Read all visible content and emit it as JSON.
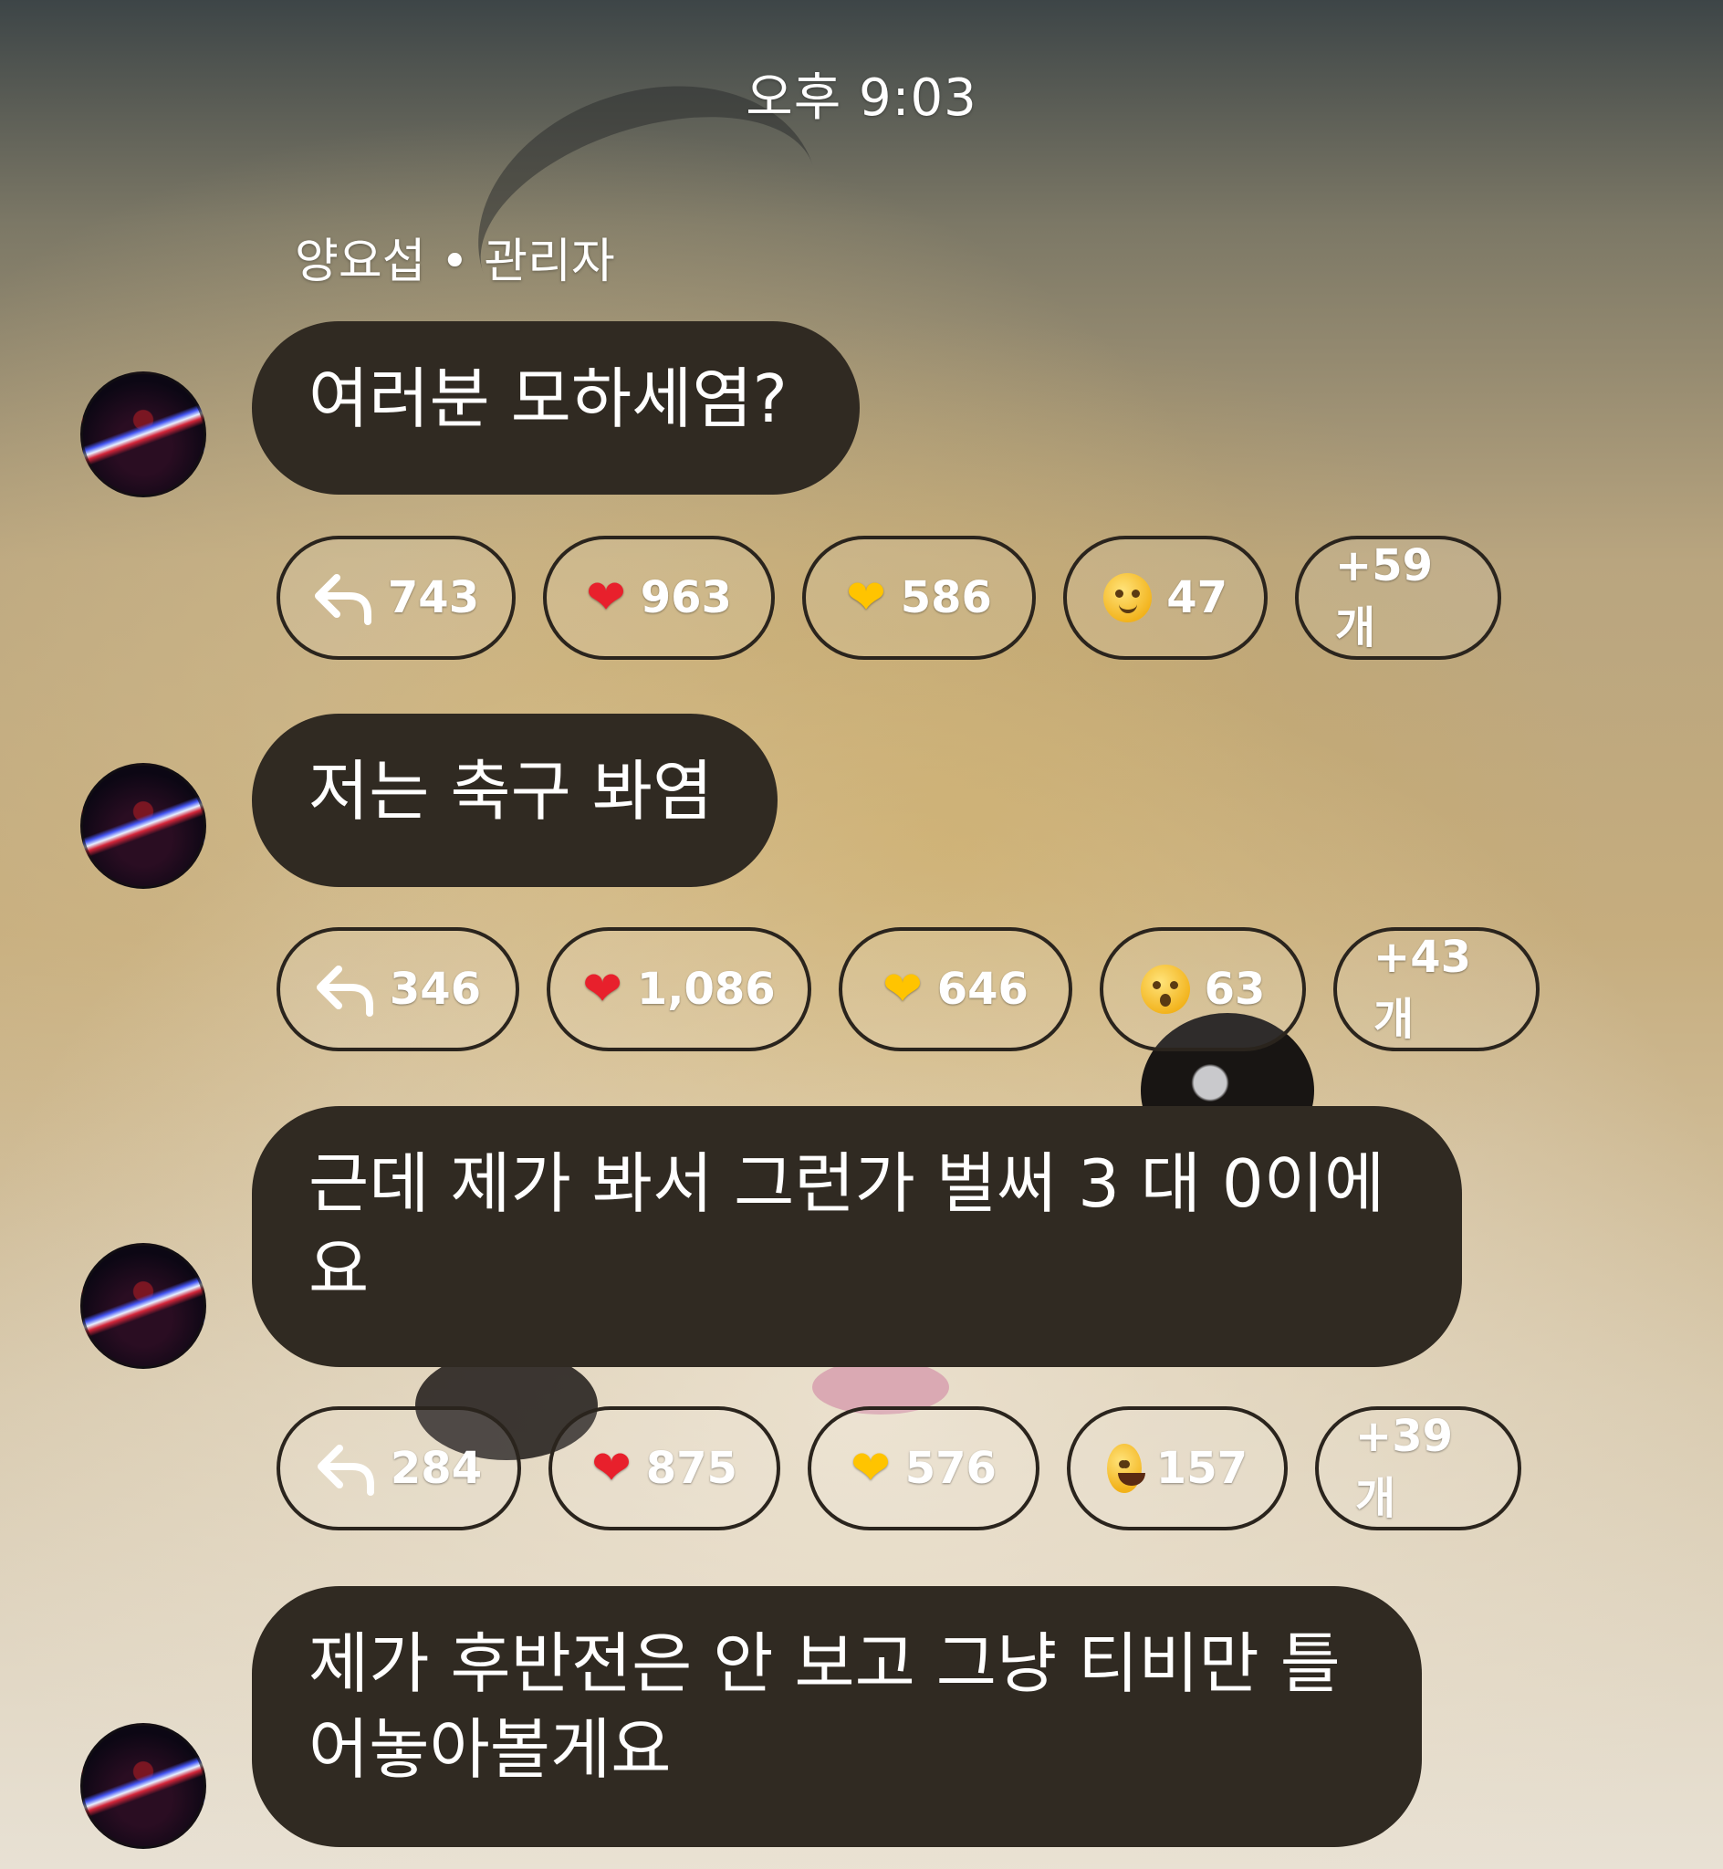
{
  "status": {
    "time": "오후 9:03"
  },
  "sender": {
    "label": "양요섭 • 관리자"
  },
  "messages": [
    {
      "text": "여러분 모하세염?",
      "replies": "743",
      "reactions": [
        {
          "icon": "red-heart",
          "count": "963"
        },
        {
          "icon": "yellow-heart",
          "count": "586"
        },
        {
          "icon": "smiling-face-blush",
          "count": "47"
        }
      ],
      "more": "+59개"
    },
    {
      "text": "저는 축구 봐염",
      "replies": "346",
      "reactions": [
        {
          "icon": "red-heart",
          "count": "1,086"
        },
        {
          "icon": "yellow-heart",
          "count": "646"
        },
        {
          "icon": "surprised-face",
          "count": "63"
        }
      ],
      "more": "+43개"
    },
    {
      "text": "근데 제가 봐서 그런가 벌써 3 대 0이에요",
      "replies": "284",
      "reactions": [
        {
          "icon": "red-heart",
          "count": "875"
        },
        {
          "icon": "yellow-heart",
          "count": "576"
        },
        {
          "icon": "tears-of-joy-face",
          "count": "157"
        }
      ],
      "more": "+39개"
    },
    {
      "text": "제가 후반전은 안 보고 그냥 티비만 틀어놓아볼게요"
    }
  ],
  "colors": {
    "bubble": "#302a22",
    "pill_border": "#2a241d",
    "text": "#ffffff"
  }
}
